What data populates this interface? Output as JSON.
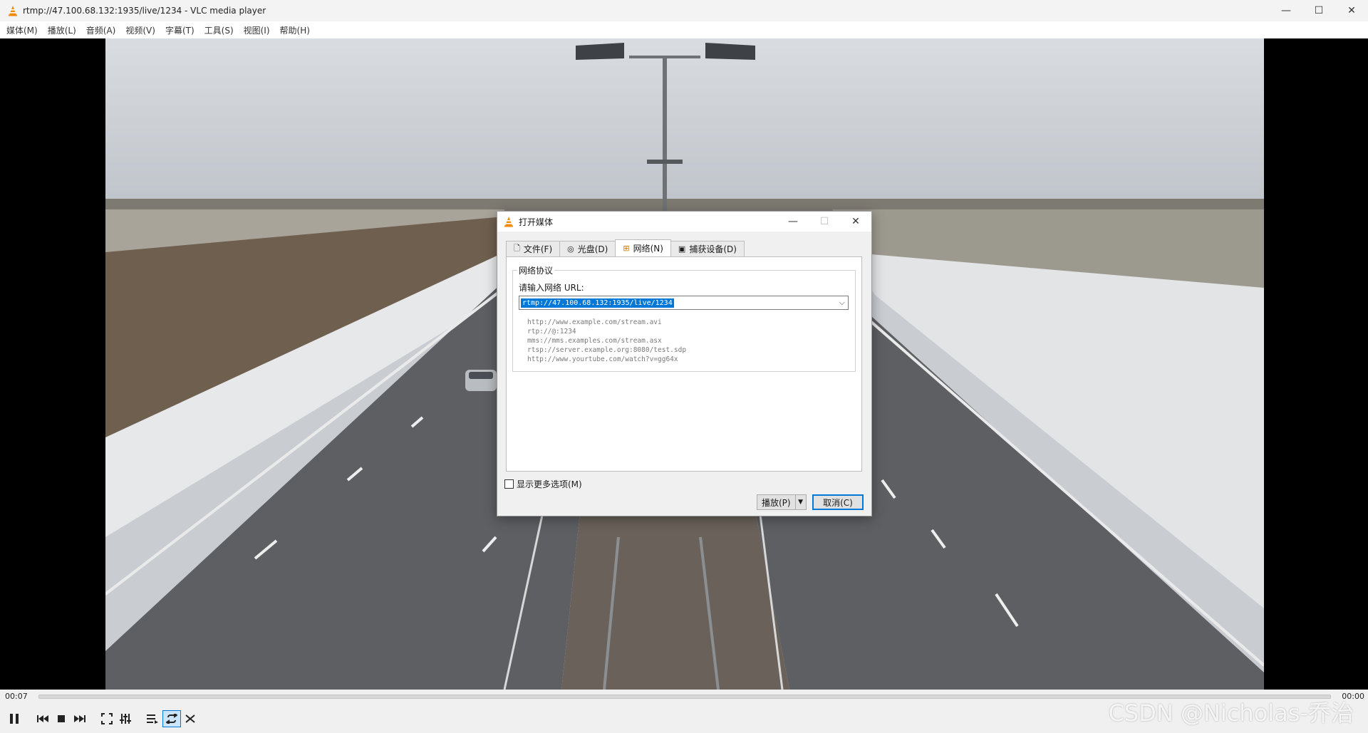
{
  "window": {
    "title": "rtmp://47.100.68.132:1935/live/1234 - VLC media player",
    "minimize": "—",
    "maximize": "☐",
    "close": "✕"
  },
  "menubar": {
    "items": [
      {
        "label": "媒体(M)"
      },
      {
        "label": "播放(L)"
      },
      {
        "label": "音频(A)"
      },
      {
        "label": "视频(V)"
      },
      {
        "label": "字幕(T)"
      },
      {
        "label": "工具(S)"
      },
      {
        "label": "视图(I)"
      },
      {
        "label": "帮助(H)"
      }
    ]
  },
  "player": {
    "elapsed": "00:07",
    "total": "00:00",
    "seek_progress": 0
  },
  "watermark": "CSDN @Nicholas-乔治",
  "dialog": {
    "title": "打开媒体",
    "minimize": "—",
    "maximize": "☐",
    "close": "✕",
    "tabs": [
      {
        "label": "文件(F)",
        "icon": "file-icon"
      },
      {
        "label": "光盘(D)",
        "icon": "disc-icon"
      },
      {
        "label": "网络(N)",
        "icon": "network-icon"
      },
      {
        "label": "捕获设备(D)",
        "icon": "capture-device-icon"
      }
    ],
    "active_tab": "网络(N)",
    "group_title": "网络协议",
    "url_label": "请输入网络 URL:",
    "url_value": "rtmp://47.100.68.132:1935/live/1234",
    "examples": [
      "http://www.example.com/stream.avi",
      "rtp://@:1234",
      "mms://mms.examples.com/stream.asx",
      "rtsp://server.example.org:8080/test.sdp",
      "http://www.yourtube.com/watch?v=gg64x"
    ],
    "show_more_options": "显示更多选项(M)",
    "show_more_checked": false,
    "play_button": "播放(P)",
    "cancel_button": "取消(C)"
  },
  "colors": {
    "accent": "#0078d7",
    "vlc_orange": "#f08a00"
  }
}
